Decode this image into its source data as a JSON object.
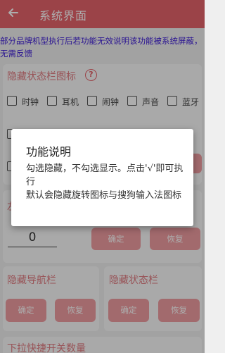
{
  "appbar": {
    "title": "系统界面",
    "back_icon": "arrow-left-icon"
  },
  "notice": {
    "line1": "部分品牌机型执行后若功能无效说明该功能被系统屏蔽，",
    "line2": "无需反馈"
  },
  "hide_statusbar_icons": {
    "title": "隐藏状态栏图标",
    "help_glyph": "?",
    "options": [
      "时钟",
      "耳机",
      "闹钟",
      "声音",
      "蓝牙"
    ]
  },
  "mid_section": {
    "title": "左",
    "value": "0",
    "confirm_label": "确定",
    "restore_label": "恢复"
  },
  "hide_navbar": {
    "title": "隐藏导航栏",
    "confirm_label": "确定",
    "restore_label": "恢复"
  },
  "hide_statusbar": {
    "title": "隐藏状态栏",
    "confirm_label": "确定",
    "restore_label": "恢复"
  },
  "pulldown_section": {
    "title": "下拉快捷开关数量"
  },
  "dialog": {
    "title": "功能说明",
    "line1": "勾选隐藏，不勾选显示。点击'√'即可执行",
    "line2": "默认会隐藏旋转图标与搜狗输入法图标"
  },
  "colors": {
    "accent": "#e5646a",
    "button": "#ef9da1",
    "notice": "#3b1ad6"
  }
}
